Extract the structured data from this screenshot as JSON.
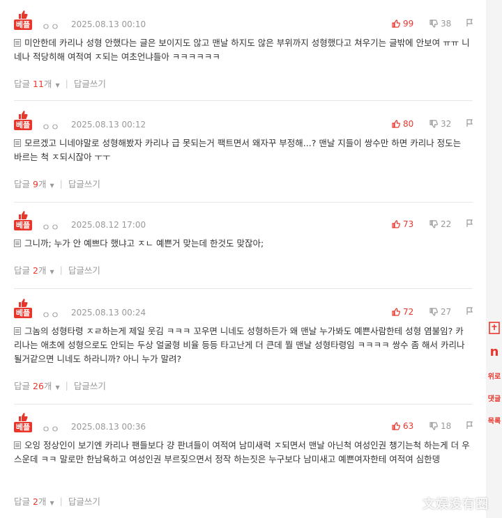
{
  "comments": [
    {
      "badge": "베플",
      "nick": "ㅇㅇ",
      "date": "2025.08.13 00:10",
      "likes": "99",
      "dislikes": "38",
      "text": "미안한데 카리나 성형 안했다는 글은 보이지도 않고 맨날 하지도 않은 부위까지 성형했다고 쳐우기는 글밖에 안보여 ㅠㅠ 니네나 적당히해 여적여 ㅈ되는 여초언냐들아 ㅋㅋㅋㅋㅋㅋ",
      "reply_prefix": "답글",
      "reply_count": "11",
      "reply_unit": "개",
      "write_reply": "답글쓰기"
    },
    {
      "badge": "베플",
      "nick": "ㅇㅇ",
      "date": "2025.08.13 00:12",
      "likes": "80",
      "dislikes": "32",
      "text": "모르겠고 니네야말로 성형해봤자 카리나 급 못되는거 팩트면서 왜자꾸 부정해...? 맨날 지들이 쌍수만 하면 카리나 정도는 바르는 척 ㅈ되시잖아 ㅜㅜ",
      "reply_prefix": "답글",
      "reply_count": "9",
      "reply_unit": "개",
      "write_reply": "답글쓰기"
    },
    {
      "badge": "베플",
      "nick": "ㅇㅇ",
      "date": "2025.08.12 17:00",
      "likes": "73",
      "dislikes": "22",
      "text": "그니까; 누가 안 예쁘다 했냐고 ㅈㄴ 예쁜거 맞는데 한것도 맞잖아;",
      "reply_prefix": "답글",
      "reply_count": "2",
      "reply_unit": "개",
      "write_reply": "답글쓰기"
    },
    {
      "badge": "베플",
      "nick": "ㅇㅇ",
      "date": "2025.08.13 00:24",
      "likes": "72",
      "dislikes": "27",
      "text": "그놈의 성형타령 ㅈㄹ하는게 제일 웃김 ㅋㅋㅋ 꼬우면 니네도 성형하든가 왜 맨날 누가봐도 예쁜사람한테 성형 염불임? 카리나는 애초에 성형으로도 안되는 두상 얼굴형 비율 등등 타고난게 더 큰데 뭘 맨날 성형타령임 ㅋㅋㅋㅋ 쌍수 좀 해서 카리나 될거같으면 니네도 하라니까? 아니 누가 말려?",
      "reply_prefix": "답글",
      "reply_count": "26",
      "reply_unit": "개",
      "write_reply": "답글쓰기"
    },
    {
      "badge": "베플",
      "nick": "ㅇㅇ",
      "date": "2025.08.13 00:36",
      "likes": "63",
      "dislikes": "18",
      "text": "오잉 정상인이 보기엔 카리나 팬들보다 걍 판녀들이 여적여 남미새력 ㅈ되면서 맨날 아닌척 여성인권 챙기는척 하는게 더 우스운데 ㅋㅋ 말로만 한남욕하고 여성인권 부르짖으면서 정작 하는짓은 누구보다 남미새고 예쁜여자한테 여적여 심한뎅",
      "reply_prefix": "답글",
      "reply_count": "2",
      "reply_unit": "개",
      "write_reply": "답글쓰기"
    }
  ],
  "sidebar": {
    "btn1": "",
    "btn2": "n",
    "btn3": "위로",
    "btn4": "댓글",
    "btn5": "목록"
  },
  "watermark": "文娱没有圈",
  "colors": {
    "accent": "#e8362c",
    "muted": "#999999"
  }
}
